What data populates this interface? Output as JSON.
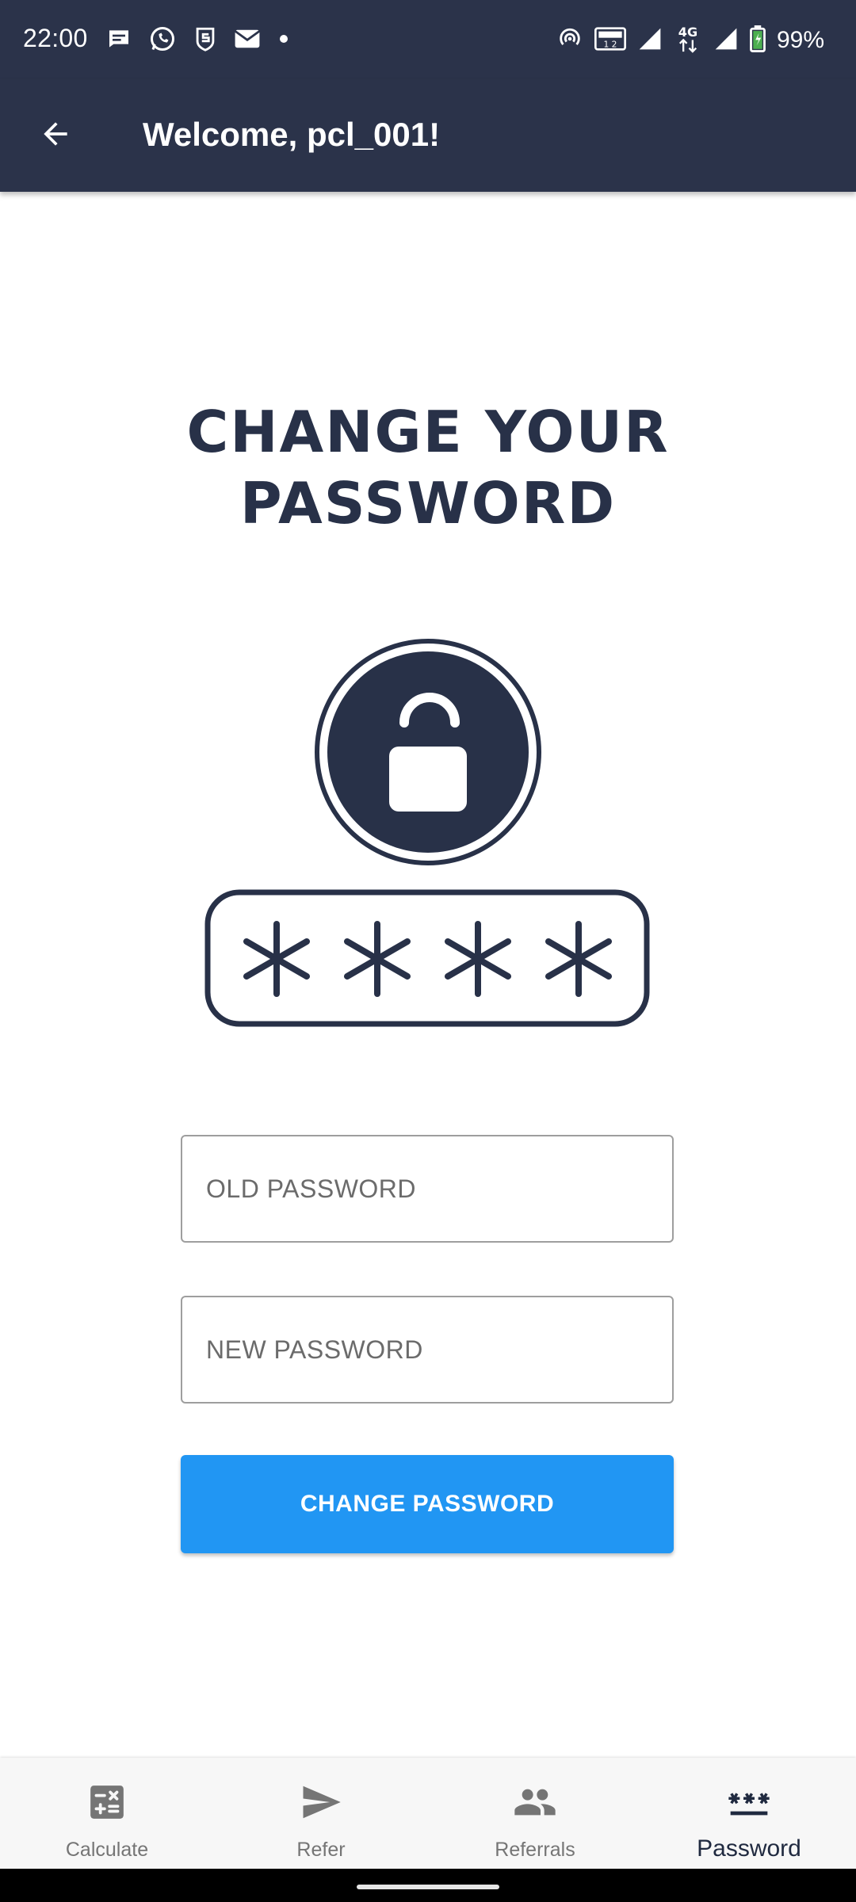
{
  "status_bar": {
    "time": "22:00",
    "battery": "99%",
    "notification_icons": [
      "message-icon",
      "whatsapp-icon",
      "shield-s-icon",
      "mail-icon",
      "dot-icon"
    ],
    "system_icons": [
      "hotspot-icon",
      "volte-icon",
      "signal-icon",
      "network-4g-icon",
      "signal-icon",
      "battery-icon"
    ]
  },
  "app_bar": {
    "title": "Welcome, pcl_001!",
    "back_icon": "arrow-back-icon",
    "background_color": "#2b334a"
  },
  "main": {
    "heading": "CHANGE YOUR PASSWORD",
    "illustration": "unlocked-padlock-and-password-asterisks",
    "old_password_placeholder": "OLD PASSWORD",
    "new_password_placeholder": "NEW PASSWORD",
    "submit_label": "CHANGE PASSWORD",
    "accent_color": "#2196f3",
    "heading_color": "#283148"
  },
  "bottom_nav": {
    "items": [
      {
        "label": "Calculate",
        "icon": "calculator-icon",
        "active": false
      },
      {
        "label": "Refer",
        "icon": "send-icon",
        "active": false
      },
      {
        "label": "Referrals",
        "icon": "people-icon",
        "active": false
      },
      {
        "label": "Password",
        "icon": "password-icon",
        "active": true
      }
    ]
  }
}
